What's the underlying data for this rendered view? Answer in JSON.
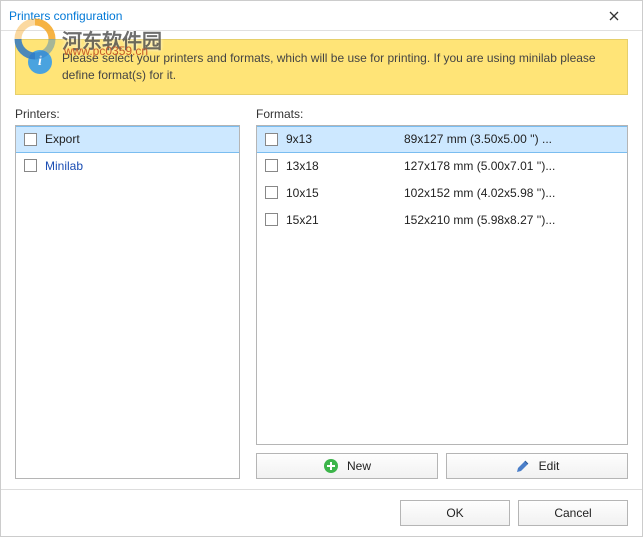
{
  "window": {
    "title": "Printers configuration"
  },
  "banner": {
    "text": "Please select your printers and formats, which will be use for printing. If you are using minilab please define format(s) for it."
  },
  "printers": {
    "label": "Printers:",
    "items": [
      {
        "name": "Export",
        "selected": true,
        "link": false
      },
      {
        "name": "Minilab",
        "selected": false,
        "link": true
      }
    ]
  },
  "formats": {
    "label": "Formats:",
    "items": [
      {
        "name": "9x13",
        "dims": "89x127 mm (3.50x5.00 '') ...",
        "selected": true
      },
      {
        "name": "13x18",
        "dims": "127x178 mm (5.00x7.01 '')...",
        "selected": false
      },
      {
        "name": "10x15",
        "dims": "102x152 mm (4.02x5.98 '')...",
        "selected": false
      },
      {
        "name": "15x21",
        "dims": "152x210 mm (5.98x8.27 '')...",
        "selected": false
      }
    ]
  },
  "buttons": {
    "new": "New",
    "edit": "Edit",
    "ok": "OK",
    "cancel": "Cancel"
  },
  "watermark": {
    "main": "河东软件园",
    "sub": "www.pc0359.cn"
  }
}
